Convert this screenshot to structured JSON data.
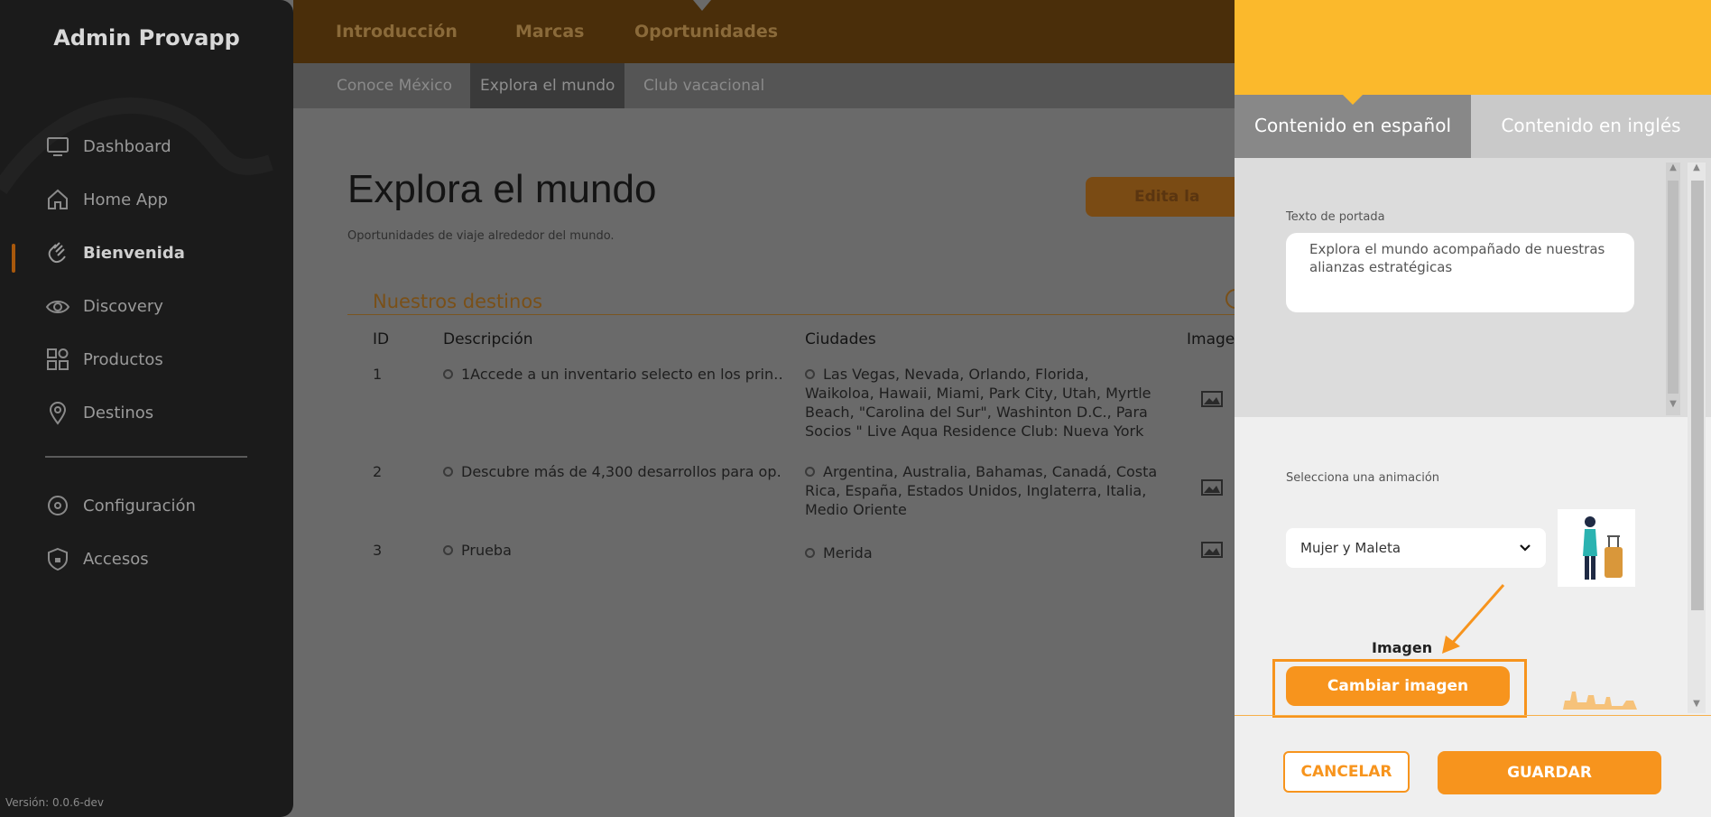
{
  "sidebar": {
    "brand": "Admin Provapp",
    "items": [
      {
        "label": "Dashboard",
        "icon": "monitor-icon"
      },
      {
        "label": "Home App",
        "icon": "home-icon"
      },
      {
        "label": "Bienvenida",
        "icon": "hand-wave-icon"
      },
      {
        "label": "Discovery",
        "icon": "eye-icon"
      },
      {
        "label": "Productos",
        "icon": "grid-icon"
      },
      {
        "label": "Destinos",
        "icon": "map-pin-icon"
      }
    ],
    "bottom_items": [
      {
        "label": "Configuración",
        "icon": "gear-icon"
      },
      {
        "label": "Accesos",
        "icon": "shield-icon"
      }
    ],
    "version": "Versión: 0.0.6-dev"
  },
  "topnav": {
    "items": [
      "Introducción",
      "Marcas",
      "Oportunidades"
    ]
  },
  "subnav": {
    "items": [
      "Conoce México",
      "Explora el mundo",
      "Club vacacional"
    ]
  },
  "main": {
    "title": "Explora el mundo",
    "subtitle": "Oportunidades de viaje alrededor del mundo.",
    "edit_button": "Edita la portada",
    "section_title": "Nuestros destinos",
    "columns": [
      "ID",
      "Descripción",
      "Ciudades",
      "Imagen"
    ],
    "rows": [
      {
        "id": "1",
        "desc": "1Accede a un inventario selecto en los prin…",
        "cities": "Las Vegas, Nevada, Orlando, Florida, Waikoloa, Hawaii, Miami, Park City, Utah, Myrtle Beach, \"Carolina del Sur\", Washinton D.C., Para Socios \" Live Aqua Residence Club: Nueva York"
      },
      {
        "id": "2",
        "desc": "Descubre más de 4,300 desarrollos para op…",
        "cities": "Argentina, Australia, Bahamas, Canadá, Costa Rica, España, Estados Unidos, Inglaterra, Italia, Medio Oriente"
      },
      {
        "id": "3",
        "desc": "Prueba",
        "cities": "Merida"
      }
    ]
  },
  "panel": {
    "tab_es": "Contenido en español",
    "tab_en": "Contenido en inglés",
    "cover_label": "Texto de portada",
    "cover_text": "Explora el mundo acompañado de nuestras alianzas estratégicas",
    "anim_label": "Selecciona una animación",
    "anim_value": "Mujer y Maleta",
    "image_label": "Imagen",
    "change_image": "Cambiar imagen",
    "cancel": "CANCELAR",
    "save": "GUARDAR"
  },
  "colors": {
    "accent": "#f7941d",
    "panel_head": "#fbb92c",
    "sidebar": "#1b1b1b"
  }
}
